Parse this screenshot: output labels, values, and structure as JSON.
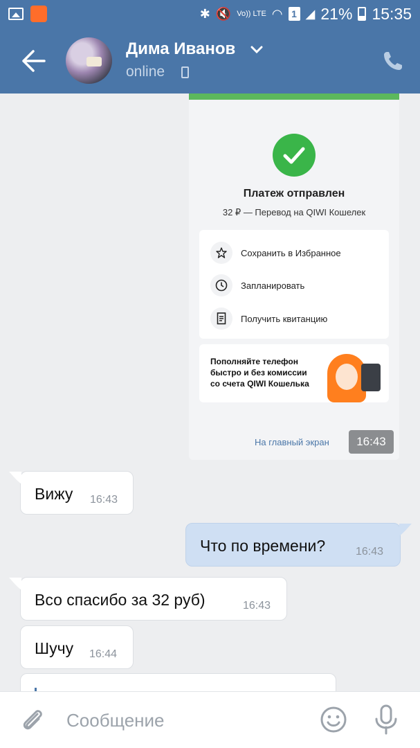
{
  "status_bar": {
    "network": "Vo)) LTE",
    "sim": "1",
    "battery": "21%",
    "time": "15:35"
  },
  "header": {
    "name": "Дима Иванов",
    "status": "online"
  },
  "screenshot": {
    "title": "Платеж отправлен",
    "subtitle": "32 ₽ — Перевод на QIWI Кошелек",
    "actions": [
      "Сохранить в Избранное",
      "Запланировать",
      "Получить квитанцию"
    ],
    "promo": [
      "Пополняйте телефон",
      "быстро и без комиссии",
      "со счета QIWI Кошелька"
    ],
    "home_link": "На главный экран",
    "time": "16:43"
  },
  "messages": [
    {
      "text": "Вижу",
      "time": "16:43",
      "direction": "in"
    },
    {
      "text": "Что по времени?",
      "time": "16:43",
      "direction": "out"
    },
    {
      "text": "Всо спасибо за 32 руб)",
      "time": "16:43",
      "direction": "in"
    },
    {
      "text": "Шучу",
      "time": "16:44",
      "direction": "in"
    }
  ],
  "input": {
    "placeholder": "Сообщение"
  },
  "colors": {
    "header": "#4a76a8",
    "background": "#edeef0",
    "outgoing_bubble": "#cfdff3",
    "success": "#3ab549"
  }
}
